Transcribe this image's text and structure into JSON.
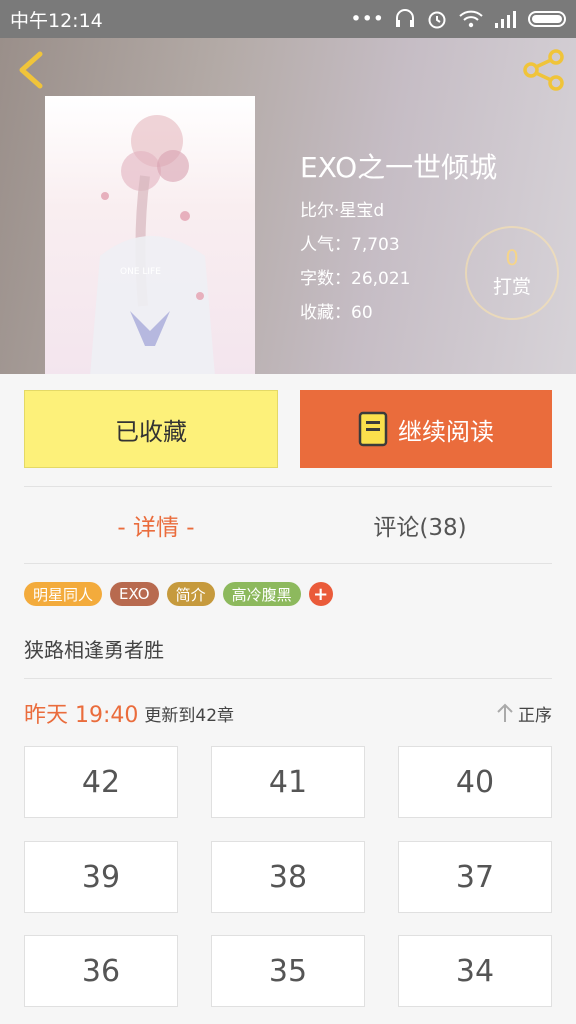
{
  "status": {
    "time": "中午12:14"
  },
  "book": {
    "title": "EXO之一世倾城",
    "author": "比尔·星宝d",
    "popularity": "人气：7,703",
    "word_count": "字数：26,021",
    "favorites": "收藏：60",
    "cover_text": "ONE LIFE"
  },
  "tip": {
    "count": "0",
    "label": "打赏"
  },
  "actions": {
    "favorite_label": "已收藏",
    "read_label": "继续阅读"
  },
  "tabs": {
    "detail": "- 详情 -",
    "comments": "评论(38)"
  },
  "tags": [
    {
      "label": "明星同人",
      "color": "#f3ab3c"
    },
    {
      "label": "EXO",
      "color": "#b86a4f"
    },
    {
      "label": "简介",
      "color": "#c69a3d"
    },
    {
      "label": "高冷腹黑",
      "color": "#8db95d"
    },
    {
      "label": "+",
      "color": "#ea5b3a"
    }
  ],
  "intro": "狭路相逢勇者胜",
  "update": {
    "time": "昨天 19:40",
    "text": "更新到42章",
    "sort_label": "正序"
  },
  "chapters": [
    "42",
    "41",
    "40",
    "39",
    "38",
    "37",
    "36",
    "35",
    "34"
  ],
  "colors": {
    "accent": "#ea6c3c",
    "fav_button": "#fdf17a"
  }
}
